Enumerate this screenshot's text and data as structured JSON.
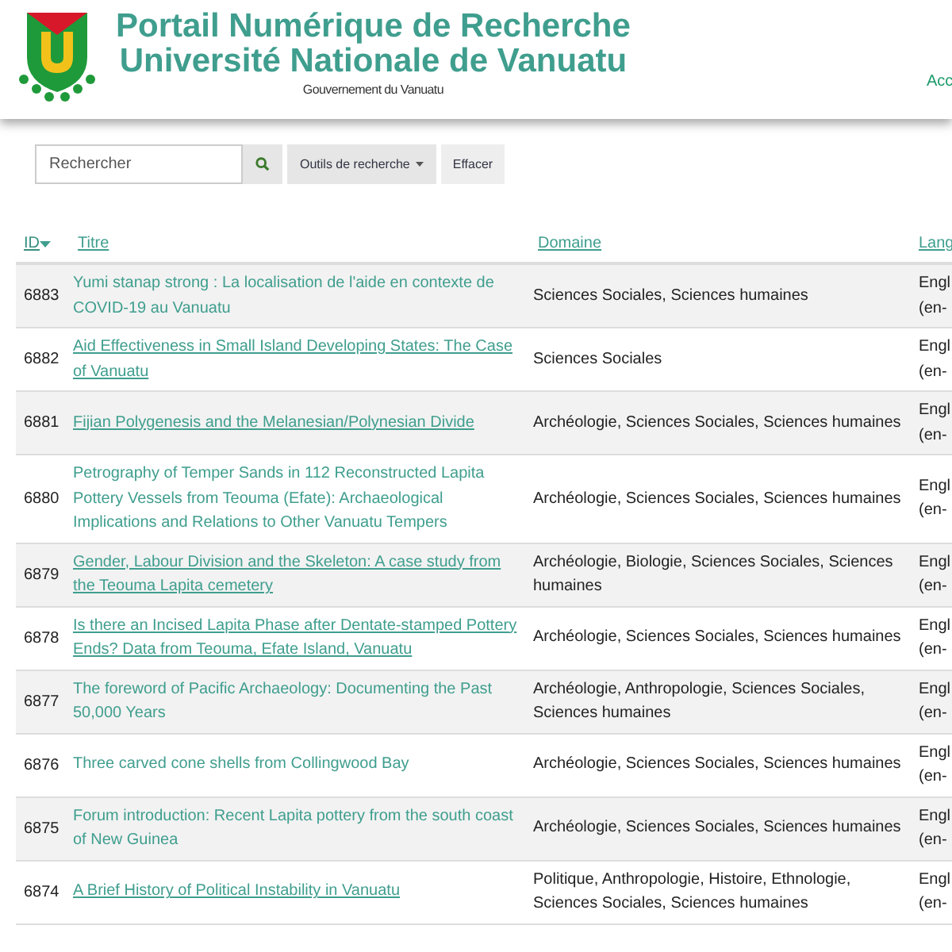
{
  "header": {
    "title_line_1": "Portail Numérique de Recherche",
    "title_line_2": "Université Nationale de Vanuatu",
    "subtitle": "Gouvernement du Vanuatu",
    "nav_link": "Acc"
  },
  "search": {
    "placeholder": "Rechercher",
    "tools_button": "Outils de recherche",
    "clear_button": "Effacer"
  },
  "table": {
    "columns": [
      {
        "label": "ID",
        "sorted": true
      },
      {
        "label": "Titre",
        "sorted": false
      },
      {
        "label": "Domaine",
        "sorted": false
      },
      {
        "label": "Lang",
        "sorted": false
      }
    ],
    "rows": [
      {
        "id": "6883",
        "title": "Yumi stanap strong : La localisation de l'aide en contexte de COVID-19 au Vanuatu",
        "underlined": false,
        "domain": "Sciences Sociales, Sciences humaines",
        "language": "Engl (en-"
      },
      {
        "id": "6882",
        "title": "Aid Effectiveness in Small Island Developing States: The Case of Vanuatu",
        "underlined": true,
        "domain": "Sciences Sociales",
        "language": "Engl (en-"
      },
      {
        "id": "6881",
        "title": "Fijian Polygenesis and the Melanesian/Polynesian Divide",
        "underlined": true,
        "domain": "Archéologie, Sciences Sociales, Sciences humaines",
        "language": "Engl (en-"
      },
      {
        "id": "6880",
        "title": "Petrography of Temper Sands in 112 Reconstructed Lapita Pottery Vessels from Teouma (Efate): Archaeological Implications and Relations to Other Vanuatu Tempers",
        "underlined": false,
        "domain": "Archéologie, Sciences Sociales, Sciences humaines",
        "language": "Engl (en-"
      },
      {
        "id": "6879",
        "title": "Gender, Labour Division and the Skeleton: A case study from the Teouma Lapita cemetery",
        "underlined": true,
        "domain": "Archéologie, Biologie, Sciences Sociales, Sciences humaines",
        "language": "Engl (en-"
      },
      {
        "id": "6878",
        "title": "Is there an Incised Lapita Phase after Dentate-stamped Pottery Ends? Data from Teouma, Efate Island, Vanuatu",
        "underlined": true,
        "domain": "Archéologie, Sciences Sociales, Sciences humaines",
        "language": "Engl (en-"
      },
      {
        "id": "6877",
        "title": "The foreword of Pacific Archaeology: Documenting the Past 50,000 Years",
        "underlined": false,
        "domain": "Archéologie, Anthropologie, Sciences Sociales, Sciences humaines",
        "language": "Engl (en-"
      },
      {
        "id": "6876",
        "title": "Three carved cone shells from Collingwood Bay",
        "underlined": false,
        "domain": "Archéologie, Sciences Sociales, Sciences humaines",
        "language": "Engl (en-"
      },
      {
        "id": "6875",
        "title": "Forum introduction: Recent Lapita pottery from the south coast of New Guinea",
        "underlined": false,
        "domain": "Archéologie, Sciences Sociales, Sciences humaines",
        "language": "Engl (en-"
      },
      {
        "id": "6874",
        "title": "A Brief History of Political Instability in Vanuatu",
        "underlined": true,
        "domain": "Politique, Anthropologie, Histoire, Ethnologie, Sciences Sociales, Sciences humaines",
        "language": "Engl (en-"
      }
    ]
  }
}
